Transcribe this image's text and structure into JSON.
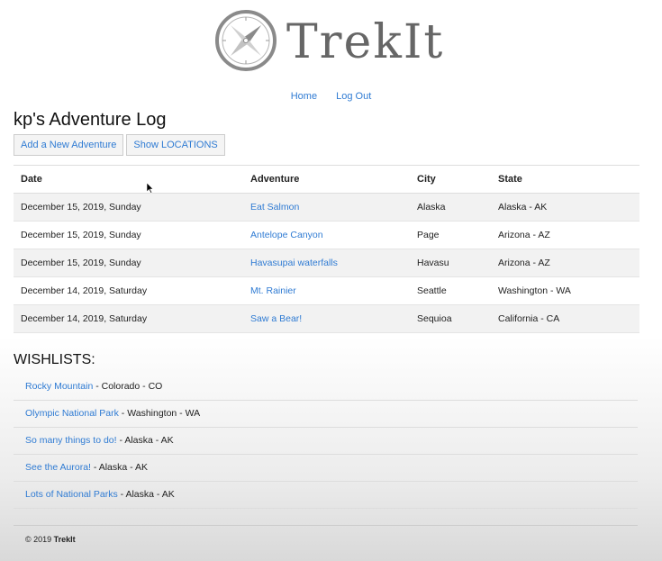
{
  "brand": {
    "name": "TrekIt",
    "logo_icon": "compass-icon"
  },
  "nav": {
    "home": "Home",
    "logout": "Log Out"
  },
  "page_title": "kp's Adventure Log",
  "buttons": {
    "add_adventure": "Add a New Adventure",
    "show_locations": "Show LOCATIONS"
  },
  "log_table": {
    "headers": [
      "Date",
      "Adventure",
      "City",
      "State"
    ],
    "rows": [
      {
        "date": "December 15, 2019, Sunday",
        "adventure": "Eat Salmon",
        "city": "Alaska",
        "state": "Alaska - AK"
      },
      {
        "date": "December 15, 2019, Sunday",
        "adventure": "Antelope Canyon",
        "city": "Page",
        "state": "Arizona - AZ"
      },
      {
        "date": "December 15, 2019, Sunday",
        "adventure": "Havasupai waterfalls",
        "city": "Havasu",
        "state": "Arizona - AZ"
      },
      {
        "date": "December 14, 2019, Saturday",
        "adventure": "Mt. Rainier",
        "city": "Seattle",
        "state": "Washington - WA"
      },
      {
        "date": "December 14, 2019, Saturday",
        "adventure": "Saw a Bear!",
        "city": "Sequioa",
        "state": "California - CA"
      }
    ]
  },
  "wishlists": {
    "title": "WISHLISTS:",
    "items": [
      {
        "name": "Rocky Mountain",
        "location": " - Colorado - CO"
      },
      {
        "name": "Olympic National Park",
        "location": " - Washington - WA"
      },
      {
        "name": "So many things to do!",
        "location": " - Alaska - AK"
      },
      {
        "name": "See the Aurora!",
        "location": " - Alaska - AK"
      },
      {
        "name": "Lots of National Parks",
        "location": " - Alaska - AK"
      }
    ]
  },
  "footer": {
    "copyright": "© 2019 ",
    "brand": "TrekIt"
  },
  "colors": {
    "link": "#2f7bd3",
    "row_stripe": "#f2f2f2",
    "logo": "#8a8a8a"
  }
}
